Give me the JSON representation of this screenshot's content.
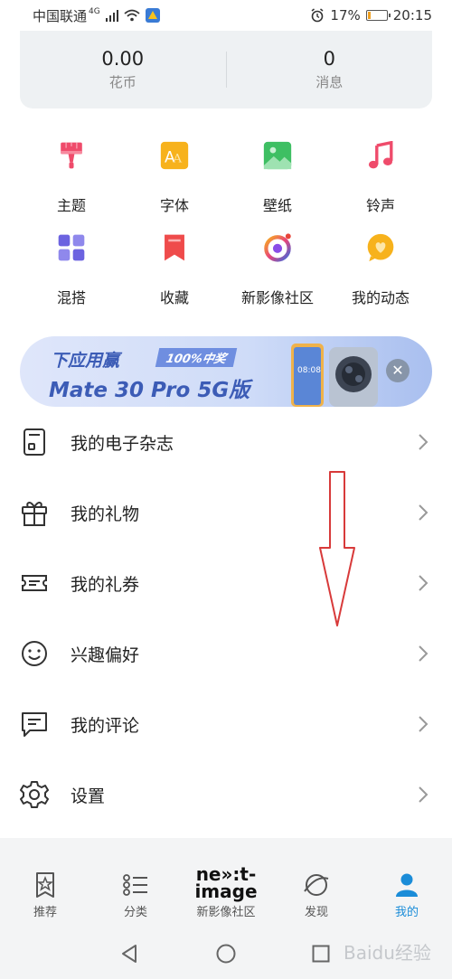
{
  "status_bar": {
    "carrier": "中国联通",
    "network": "4G",
    "battery_percent": "17%",
    "time": "20:15",
    "battery_level": 0.17
  },
  "stats": [
    {
      "value": "0.00",
      "label": "花币"
    },
    {
      "value": "0",
      "label": "消息"
    }
  ],
  "grid": [
    {
      "label": "主题",
      "icon": "brush-icon",
      "color": "#ef4b6b"
    },
    {
      "label": "字体",
      "icon": "font-icon",
      "color": "#f7b21c"
    },
    {
      "label": "壁纸",
      "icon": "wallpaper-icon",
      "color": "#3ebf63"
    },
    {
      "label": "铃声",
      "icon": "music-note-icon",
      "color": "#ef4b6b"
    },
    {
      "label": "混搭",
      "icon": "mix-grid-icon",
      "color": "#6c63e0"
    },
    {
      "label": "收藏",
      "icon": "bookmark-icon",
      "color": "#ef4b4b"
    },
    {
      "label": "新影像社区",
      "icon": "camera-ring-icon",
      "color": "#8a4de8"
    },
    {
      "label": "我的动态",
      "icon": "heart-bubble-icon",
      "color": "#f7b21c"
    }
  ],
  "banner": {
    "line1": "下应用赢",
    "badge": "100%中奖",
    "line2": "Mate 30 Pro 5G版",
    "phone_time": "08:08"
  },
  "list": [
    {
      "label": "我的电子杂志",
      "icon": "magazine-icon"
    },
    {
      "label": "我的礼物",
      "icon": "gift-icon"
    },
    {
      "label": "我的礼券",
      "icon": "coupon-icon"
    },
    {
      "label": "兴趣偏好",
      "icon": "smile-icon"
    },
    {
      "label": "我的评论",
      "icon": "comment-icon"
    },
    {
      "label": "设置",
      "icon": "gear-icon"
    }
  ],
  "bottom_nav": [
    {
      "label": "推荐",
      "icon": "star-card-icon",
      "active": false
    },
    {
      "label": "分类",
      "icon": "category-list-icon",
      "active": false
    },
    {
      "label": "新影像社区",
      "logo_line1": "ne»:t-",
      "logo_line2": "image",
      "active": false
    },
    {
      "label": "发现",
      "icon": "planet-icon",
      "active": false
    },
    {
      "label": "我的",
      "icon": "person-icon",
      "active": true
    }
  ],
  "watermark": "Baidu经验",
  "colors": {
    "accent": "#1a8cd8",
    "annotation": "#d83a3a"
  }
}
